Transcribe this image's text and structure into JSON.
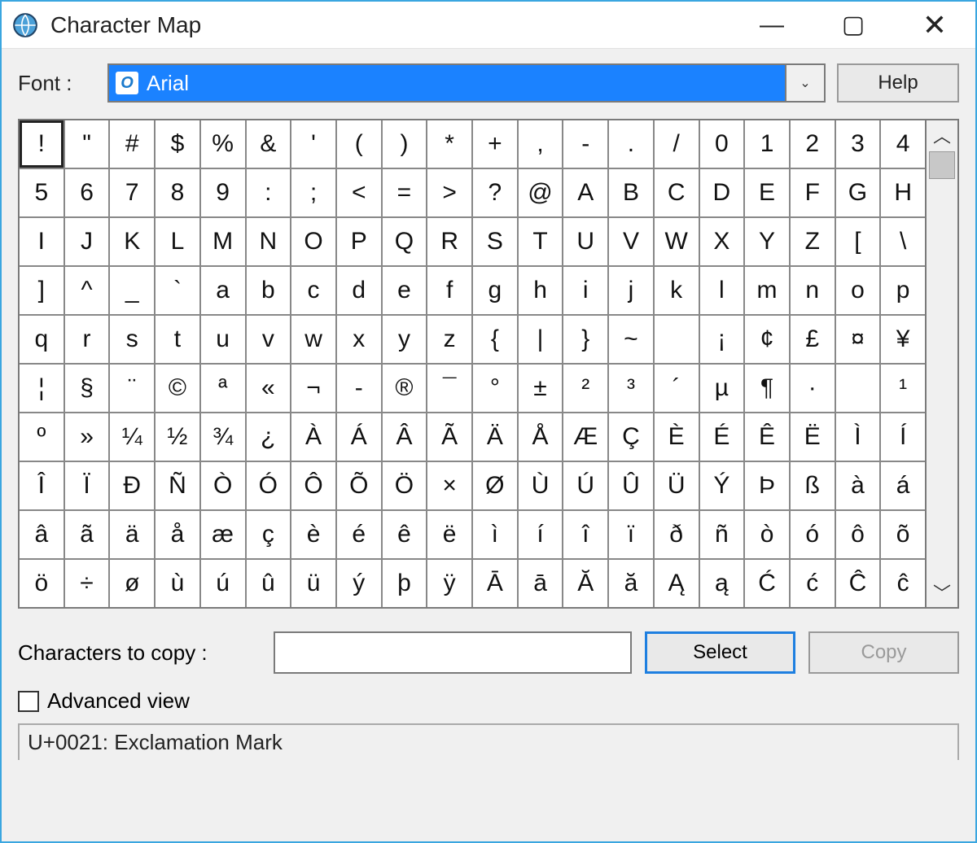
{
  "window": {
    "title": "Character Map",
    "minimize_glyph": "—",
    "maximize_glyph": "▢",
    "close_glyph": "✕"
  },
  "font": {
    "label": "Font :",
    "selected": "Arial",
    "help_label": "Help",
    "chevron": "⌄"
  },
  "grid": {
    "cols": 20,
    "selected_index": 0,
    "rows": [
      [
        "!",
        "\"",
        "#",
        "$",
        "%",
        "&",
        "'",
        "(",
        ")",
        "*",
        "+",
        ",",
        "-",
        ".",
        "/",
        "0",
        "1",
        "2",
        "3",
        "4"
      ],
      [
        "5",
        "6",
        "7",
        "8",
        "9",
        ":",
        ";",
        "<",
        "=",
        ">",
        "?",
        "@",
        "A",
        "B",
        "C",
        "D",
        "E",
        "F",
        "G",
        "H"
      ],
      [
        "I",
        "J",
        "K",
        "L",
        "M",
        "N",
        "O",
        "P",
        "Q",
        "R",
        "S",
        "T",
        "U",
        "V",
        "W",
        "X",
        "Y",
        "Z",
        "[",
        "\\"
      ],
      [
        "]",
        "^",
        "_",
        "`",
        "a",
        "b",
        "c",
        "d",
        "e",
        "f",
        "g",
        "h",
        "i",
        "j",
        "k",
        "l",
        "m",
        "n",
        "o",
        "p"
      ],
      [
        "q",
        "r",
        "s",
        "t",
        "u",
        "v",
        "w",
        "x",
        "y",
        "z",
        "{",
        "|",
        "}",
        "~",
        " ",
        "¡",
        "¢",
        "£",
        "¤",
        "¥"
      ],
      [
        "¦",
        "§",
        "¨",
        "©",
        "ª",
        "«",
        "¬",
        "-",
        "®",
        "¯",
        "°",
        "±",
        "²",
        "³",
        "´",
        "µ",
        "¶",
        "·",
        " ",
        "¹"
      ],
      [
        "º",
        "»",
        "¼",
        "½",
        "¾",
        "¿",
        "À",
        "Á",
        "Â",
        "Ã",
        "Ä",
        "Å",
        "Æ",
        "Ç",
        "È",
        "É",
        "Ê",
        "Ë",
        "Ì",
        "Í"
      ],
      [
        "Î",
        "Ï",
        "Ð",
        "Ñ",
        "Ò",
        "Ó",
        "Ô",
        "Õ",
        "Ö",
        "×",
        "Ø",
        "Ù",
        "Ú",
        "Û",
        "Ü",
        "Ý",
        "Þ",
        "ß",
        "à",
        "á"
      ],
      [
        "â",
        "ã",
        "ä",
        "å",
        "æ",
        "ç",
        "è",
        "é",
        "ê",
        "ë",
        "ì",
        "í",
        "î",
        "ï",
        "ð",
        "ñ",
        "ò",
        "ó",
        "ô",
        "õ"
      ],
      [
        "ö",
        "÷",
        "ø",
        "ù",
        "ú",
        "û",
        "ü",
        "ý",
        "þ",
        "ÿ",
        "Ā",
        "ā",
        "Ă",
        "ă",
        "Ą",
        "ą",
        "Ć",
        "ć",
        "Ĉ",
        "ĉ"
      ]
    ]
  },
  "scroll": {
    "up_glyph": "︿",
    "down_glyph": "﹀"
  },
  "copy": {
    "label": "Characters to copy :",
    "value": "",
    "select_label": "Select",
    "copy_label": "Copy"
  },
  "advanced": {
    "checked": false,
    "label": "Advanced view"
  },
  "status": {
    "text": "U+0021: Exclamation Mark"
  }
}
